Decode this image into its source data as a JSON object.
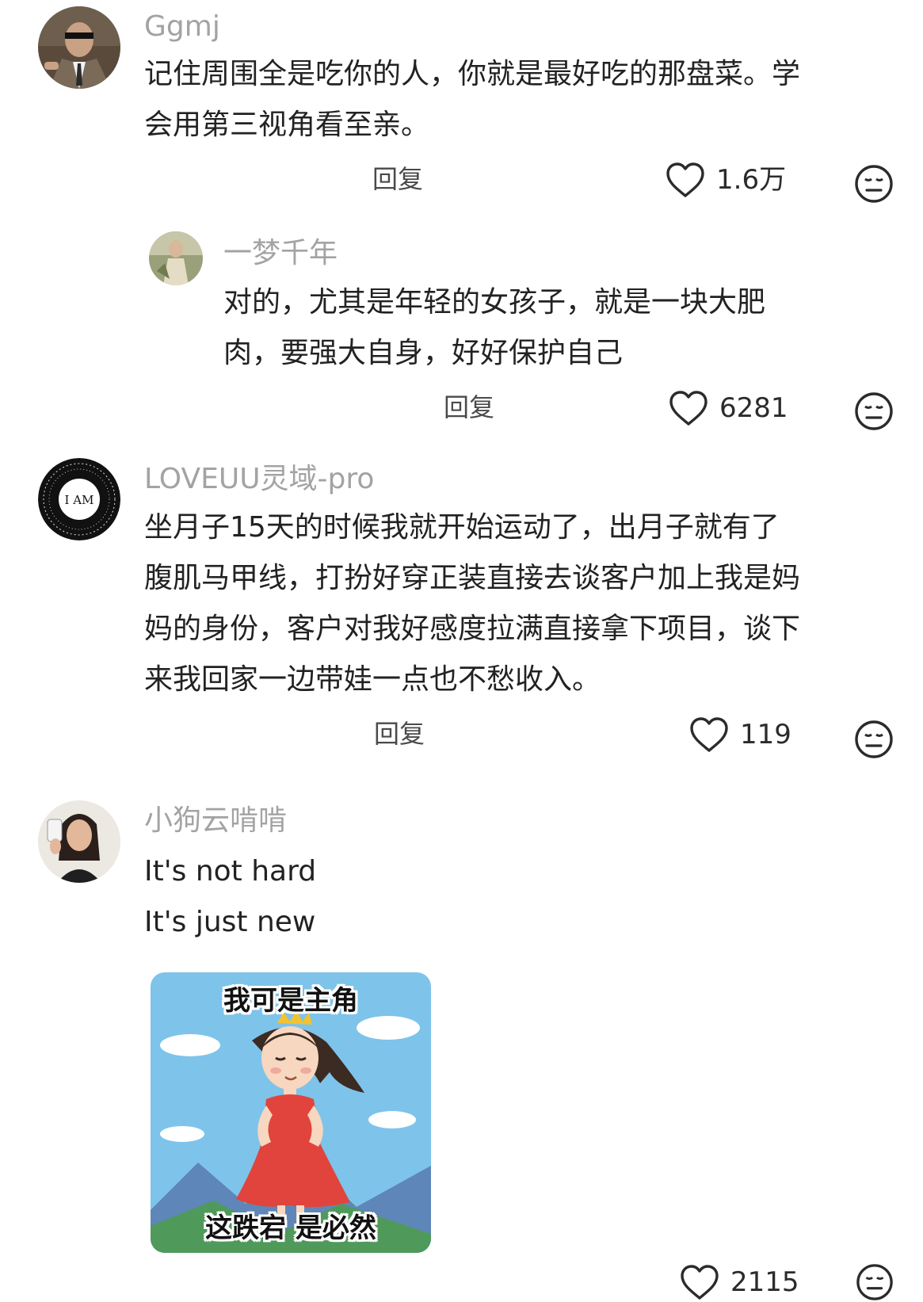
{
  "comments": [
    {
      "username": "Ggmj",
      "text_lines": [
        "记住周围全是吃你的人，你就是最好吃的那盘菜。学",
        "会用第三视角看至亲。"
      ],
      "reply_label": "回复",
      "likes": "1.6万"
    },
    {
      "username": "一梦千年",
      "text_lines": [
        "对的，尤其是年轻的女孩子，就是一块大肥",
        "肉，要强大自身，好好保护自己"
      ],
      "reply_label": "回复",
      "likes": "6281"
    },
    {
      "username": "LOVEUU灵域-pro",
      "avatar_text": "I AM",
      "text_lines": [
        "坐月子15天的时候我就开始运动了，出月子就有了",
        "腹肌马甲线，打扮好穿正装直接去谈客户加上我是妈",
        "妈的身份，客户对我好感度拉满直接拿下项目，谈下",
        "来我回家一边带娃一点也不愁收入。"
      ],
      "reply_label": "回复",
      "likes": "119"
    },
    {
      "username": "小狗云啃啃",
      "text_lines": [
        "It's not hard",
        "It's just new"
      ],
      "sticker": {
        "top_text": "我可是主角",
        "bottom_text": "这跌宕 是必然"
      },
      "likes": "2115"
    }
  ],
  "icons": {
    "like": "heart-outline-icon",
    "dislike": "meh-face-icon"
  },
  "colors": {
    "username": "#a3a3a3",
    "text": "#222222",
    "background": "#ffffff"
  }
}
